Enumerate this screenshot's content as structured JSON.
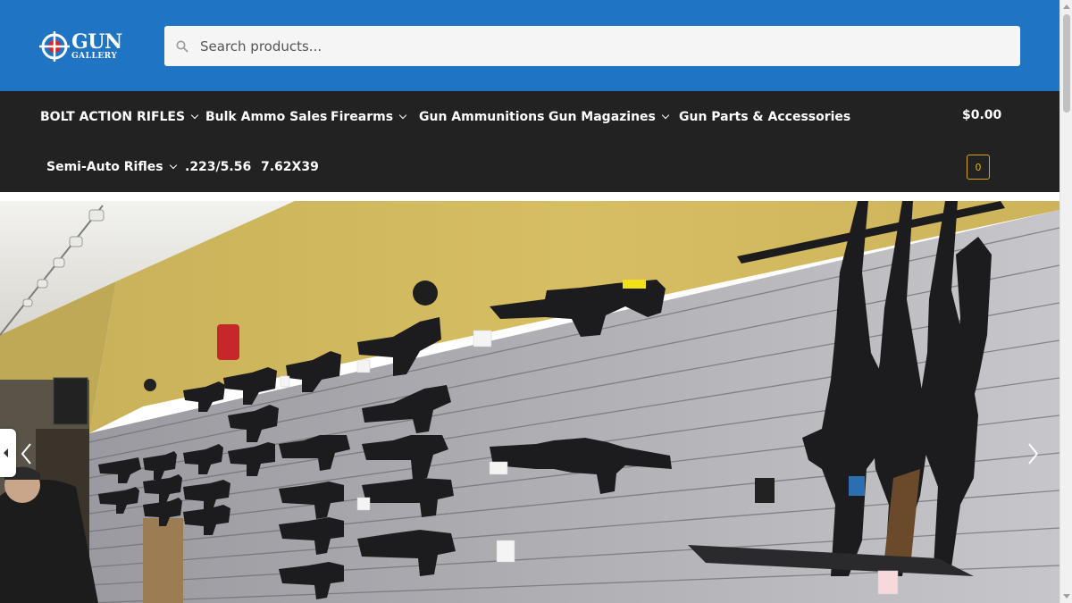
{
  "header": {
    "logo": {
      "line1": "GUN",
      "line2": "GALLERY",
      "icon": "crosshair-logo-icon"
    },
    "search": {
      "placeholder": "Search products...",
      "value": "",
      "icon": "search-icon"
    },
    "brand_color": "#1f74c4"
  },
  "nav": {
    "background": "#222222",
    "row1": [
      {
        "label": "BOLT ACTION RIFLES",
        "dropdown": true
      },
      {
        "label": "Bulk Ammo Sales",
        "dropdown": false
      },
      {
        "label": "Firearms",
        "dropdown": true
      },
      {
        "label": "Gun Ammunitions",
        "dropdown": false
      },
      {
        "label": "Gun Magazines",
        "dropdown": true
      },
      {
        "label": "Gun Parts & Accessories",
        "dropdown": false
      }
    ],
    "row2": [
      {
        "label": "Semi-Auto Rifles",
        "dropdown": true
      },
      {
        "label": ".223/5.56",
        "dropdown": false
      },
      {
        "label": "7.62X39",
        "dropdown": false
      }
    ],
    "cart": {
      "total": "$0.00",
      "count": "0",
      "badge_color": "#d8a514"
    }
  },
  "hero": {
    "image": "gun-store-display-wall",
    "prev_icon": "chevron-left-icon",
    "next_icon": "chevron-right-icon"
  }
}
